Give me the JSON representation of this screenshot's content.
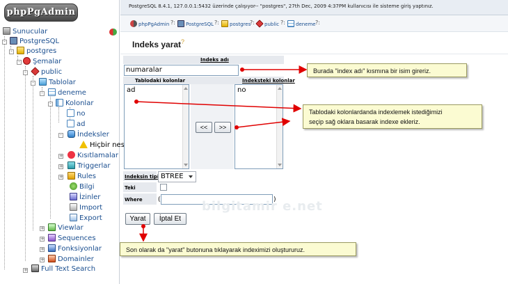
{
  "app": {
    "logo": "phpPgAdmin"
  },
  "tree": {
    "items": [
      {
        "label": "Sunucular",
        "icon": "server-icon"
      },
      {
        "label": "PostgreSQL",
        "icon": "postgres-icon"
      },
      {
        "label": "postgres",
        "icon": "database-icon"
      },
      {
        "label": "Şemalar",
        "icon": "schemas-icon"
      },
      {
        "label": "public",
        "icon": "schema-icon"
      },
      {
        "label": "Tablolar",
        "icon": "tables-icon"
      },
      {
        "label": "deneme",
        "icon": "table-icon"
      },
      {
        "label": "Kolonlar",
        "icon": "columns-icon"
      },
      {
        "label": "no",
        "icon": "column-icon"
      },
      {
        "label": "ad",
        "icon": "column-icon"
      },
      {
        "label": "İndeksler",
        "icon": "indexes-icon"
      },
      {
        "label": "Hiçbir nes",
        "icon": "warning-icon"
      },
      {
        "label": "Kısıtlamalar",
        "icon": "constraints-icon"
      },
      {
        "label": "Triggerlar",
        "icon": "triggers-icon"
      },
      {
        "label": "Rules",
        "icon": "rules-icon"
      },
      {
        "label": "Bilgi",
        "icon": "info-icon"
      },
      {
        "label": "İzinler",
        "icon": "privileges-icon"
      },
      {
        "label": "Import",
        "icon": "import-icon"
      },
      {
        "label": "Export",
        "icon": "export-icon"
      },
      {
        "label": "Viewlar",
        "icon": "views-icon"
      },
      {
        "label": "Sequences",
        "icon": "sequences-icon"
      },
      {
        "label": "Fonksiyonlar",
        "icon": "functions-icon"
      },
      {
        "label": "Domainler",
        "icon": "domains-icon"
      },
      {
        "label": "Full Text Search",
        "icon": "fulltext-icon"
      }
    ]
  },
  "header": {
    "server_info": "PostgreSQL 8.4.1, 127.0.0.1:5432 üzerinde çalışıyor-- \"postgres\", 27th Dec, 2009 4:37PM kullanıcısı ile sisteme giriş yaptınız.",
    "trail": [
      {
        "label": "phpPgAdmin",
        "icon": "elephant-icon"
      },
      {
        "label": "PostgreSQL",
        "icon": "postgres-icon"
      },
      {
        "label": "postgres",
        "icon": "database-icon"
      },
      {
        "label": "public",
        "icon": "schema-icon"
      },
      {
        "label": "deneme",
        "icon": "table-icon"
      }
    ],
    "trail_sep": "?:"
  },
  "page": {
    "title": "Indeks yarat",
    "help_mark": "?"
  },
  "form": {
    "index_name_label": "Indeks adı",
    "index_name_value": "numaralar",
    "table_columns_label": "Tablodaki kolonlar",
    "index_columns_label": "Indeksteki kolonlar",
    "table_columns": [
      "ad"
    ],
    "index_columns": [
      "no"
    ],
    "move_left": "<<",
    "move_right": ">>",
    "index_type_label": "Indeksin tipi",
    "index_type_value": "BTREE",
    "unique_label": "Teki",
    "where_label": "Where",
    "where_prefix": "(",
    "where_suffix": ")",
    "create_button": "Yarat",
    "cancel_button": "İptal Et"
  },
  "notes": {
    "note1": "Burada \"index adı\" kısmına bir isim gireriz.",
    "note2_line1": "Tablodaki kolonlardanda indexlemek istediğimizi",
    "note2_line2": "seçip sağ oklara basarak indexe ekleriz.",
    "note3": "Son olarak da \"yarat\" butonuna tıklayarak indeximizi oluştururuz."
  },
  "watermark": "bilgitamir e.net",
  "colors": {
    "link": "#1a4e8f",
    "note_bg": "#fbfbd2",
    "arrow": "#e00000"
  }
}
